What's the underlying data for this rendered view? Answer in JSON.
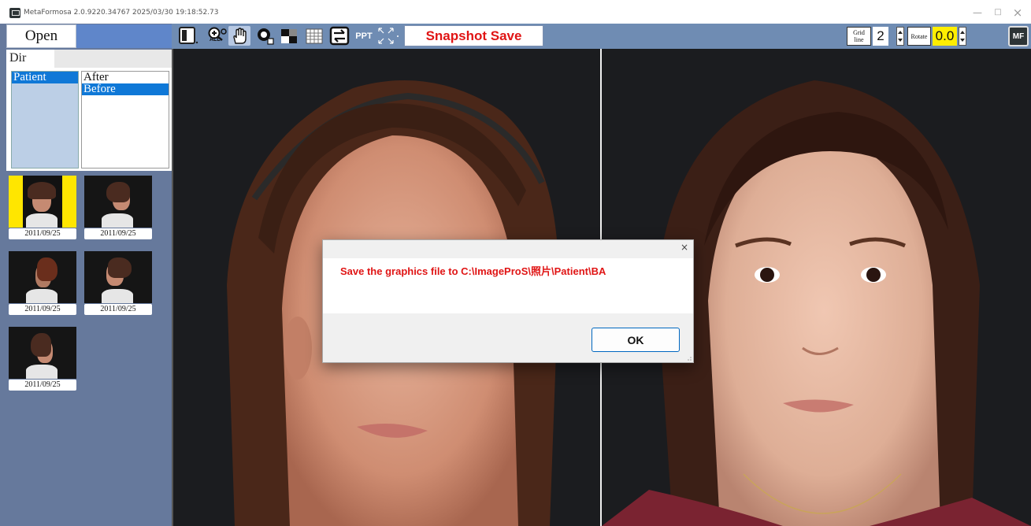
{
  "window": {
    "title": "MetaFormosa 2.0.9220.34767 2025/03/30 19:18:52.73",
    "minimize": "—",
    "maximize": "□",
    "close": "×"
  },
  "toolbar": {
    "zoom_all_label": "ALL",
    "ppt_label": "PPT",
    "snapshot_save_label": "Snapshot Save",
    "grid_line_label_1": "Grid",
    "grid_line_label_2": "line",
    "grid_value": "2",
    "rotate_label": "Rotate",
    "rotate_value": "0.0",
    "logo_text": "MF"
  },
  "left_panel": {
    "open_label": "Open",
    "dir_tab_label": "Dir",
    "tree_left": [
      "Patient"
    ],
    "tree_right": [
      "After",
      "Before"
    ]
  },
  "thumbnails": [
    {
      "date": "2011/09/25"
    },
    {
      "date": "2011/09/25"
    },
    {
      "date": "2011/09/25"
    },
    {
      "date": "2011/09/25"
    },
    {
      "date": "2011/09/25"
    }
  ],
  "dialog": {
    "message": "Save the graphics file to C:\\ImageProS\\照片\\Patient\\BA",
    "ok_label": "OK",
    "close_label": "×"
  },
  "colors": {
    "toolbar_bg": "#6f8cb3",
    "left_panel_bg": "#66799c",
    "snapshot_text": "#e01515",
    "rotate_highlight": "#ffee00",
    "selection_blue": "#0f78d7"
  }
}
